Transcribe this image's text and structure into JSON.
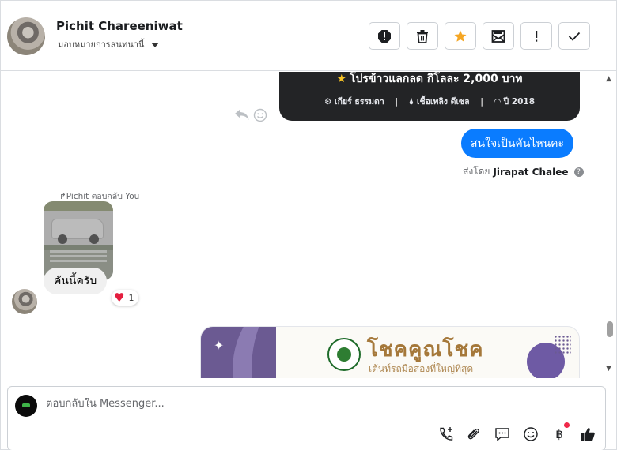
{
  "header": {
    "contact_name": "Pichit Chareeniwat",
    "assign_label": "มอบหมายการสนทนานี้",
    "buttons": [
      "spam-alert",
      "delete",
      "star",
      "mark-unread",
      "important",
      "done"
    ]
  },
  "messages": {
    "card": {
      "title": "โปรข้าวแลกลด กิโลละ 2,000 บาท",
      "specs": [
        "เกียร์ ธรรมดา",
        "เชื้อเพลิง ดีเซล",
        "ปี 2018"
      ]
    },
    "outgoing_text": "สนใจเป็นคันไหนคะ",
    "sent_by_prefix": "ส่งโดย",
    "sent_by_name": "Jirapat Chalee",
    "reply_note": "↱Pichit ตอบกลับ You",
    "incoming_text": "คันนี้ครับ",
    "reaction_count": "1",
    "promo_title": "โชคคูณโชค",
    "promo_subtitle": "เต้นท์รถมือสองที่ใหญ่ที่สุด"
  },
  "composer": {
    "placeholder": "ตอบกลับใน Messenger...",
    "tools": [
      "call-add-icon",
      "attach-icon",
      "saved-replies-icon",
      "emoji-icon",
      "baht-icon",
      "like-icon"
    ]
  },
  "colors": {
    "accent": "#0a7cff",
    "star": "#f5a623",
    "heart": "#e41e3f"
  }
}
